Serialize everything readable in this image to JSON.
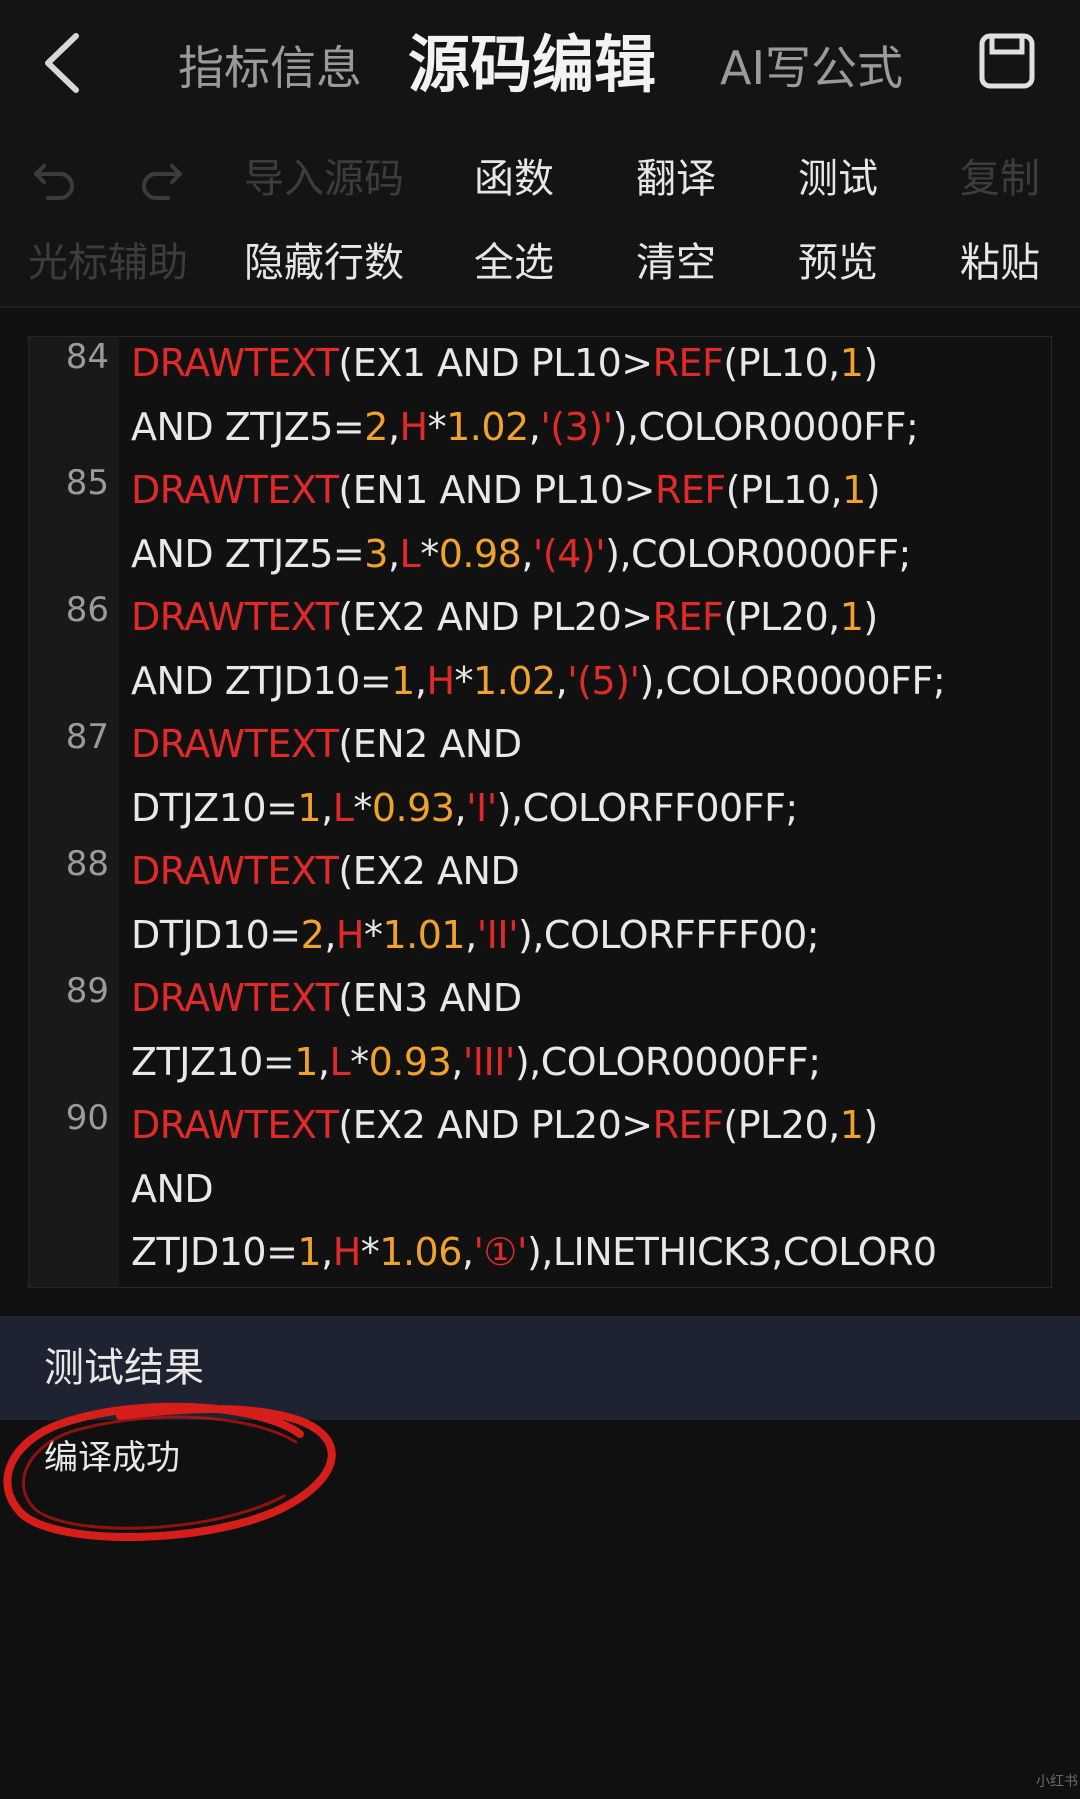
{
  "header": {
    "tabs": [
      {
        "label": "指标信息",
        "active": false
      },
      {
        "label": "源码编辑",
        "active": true
      },
      {
        "label": "AI写公式",
        "active": false
      }
    ]
  },
  "toolbar": {
    "row1": [
      "导入源码",
      "函数",
      "翻译",
      "测试",
      "复制"
    ],
    "row2": [
      "光标辅助",
      "隐藏行数",
      "全选",
      "清空",
      "预览",
      "粘贴"
    ]
  },
  "editor": {
    "line_numbers": [
      "84",
      "85",
      "86",
      "87",
      "88",
      "89",
      "90"
    ],
    "lines": [
      [
        [
          "fn",
          "DRAWTEXT"
        ],
        [
          "",
          "(EX1 AND PL10>"
        ],
        [
          "fn",
          "REF"
        ],
        [
          "",
          "(PL10,"
        ],
        [
          "num",
          "1"
        ],
        [
          "",
          ")"
        ]
      ],
      [
        [
          "",
          "AND ZTJZ5="
        ],
        [
          "num",
          "2"
        ],
        [
          "",
          ","
        ],
        [
          "fn",
          "H"
        ],
        [
          "",
          "*"
        ],
        [
          "num",
          "1.02"
        ],
        [
          "",
          ","
        ],
        [
          "str",
          "'(3)'"
        ],
        [
          "",
          "),COLOR0000FF;"
        ]
      ],
      [
        [
          "fn",
          "DRAWTEXT"
        ],
        [
          "",
          "(EN1 AND PL10>"
        ],
        [
          "fn",
          "REF"
        ],
        [
          "",
          "(PL10,"
        ],
        [
          "num",
          "1"
        ],
        [
          "",
          ")"
        ]
      ],
      [
        [
          "",
          "AND ZTJZ5="
        ],
        [
          "num",
          "3"
        ],
        [
          "",
          ","
        ],
        [
          "fn",
          "L"
        ],
        [
          "",
          "*"
        ],
        [
          "num",
          "0.98"
        ],
        [
          "",
          ","
        ],
        [
          "str",
          "'(4)'"
        ],
        [
          "",
          "),COLOR0000FF;"
        ]
      ],
      [
        [
          "fn",
          "DRAWTEXT"
        ],
        [
          "",
          "(EX2 AND PL20>"
        ],
        [
          "fn",
          "REF"
        ],
        [
          "",
          "(PL20,"
        ],
        [
          "num",
          "1"
        ],
        [
          "",
          ")"
        ]
      ],
      [
        [
          "",
          "AND ZTJD10="
        ],
        [
          "num",
          "1"
        ],
        [
          "",
          ","
        ],
        [
          "fn",
          "H"
        ],
        [
          "",
          "*"
        ],
        [
          "num",
          "1.02"
        ],
        [
          "",
          ","
        ],
        [
          "str",
          "'(5)'"
        ],
        [
          "",
          "),COLOR0000FF;"
        ]
      ],
      [
        [
          "fn",
          "DRAWTEXT"
        ],
        [
          "",
          "(EN2 AND"
        ]
      ],
      [
        [
          "",
          "DTJZ10="
        ],
        [
          "num",
          "1"
        ],
        [
          "",
          ","
        ],
        [
          "fn",
          "L"
        ],
        [
          "",
          "*"
        ],
        [
          "num",
          "0.93"
        ],
        [
          "",
          ","
        ],
        [
          "str",
          "'I'"
        ],
        [
          "",
          "),COLORFF00FF;"
        ]
      ],
      [
        [
          "fn",
          "DRAWTEXT"
        ],
        [
          "",
          "(EX2 AND"
        ]
      ],
      [
        [
          "",
          "DTJD10="
        ],
        [
          "num",
          "2"
        ],
        [
          "",
          ","
        ],
        [
          "fn",
          "H"
        ],
        [
          "",
          "*"
        ],
        [
          "num",
          "1.01"
        ],
        [
          "",
          ","
        ],
        [
          "str",
          "'II'"
        ],
        [
          "",
          "),COLORFFFF00;"
        ]
      ],
      [
        [
          "fn",
          "DRAWTEXT"
        ],
        [
          "",
          "(EN3 AND"
        ]
      ],
      [
        [
          "",
          "ZTJZ10="
        ],
        [
          "num",
          "1"
        ],
        [
          "",
          ","
        ],
        [
          "fn",
          "L"
        ],
        [
          "",
          "*"
        ],
        [
          "num",
          "0.93"
        ],
        [
          "",
          ","
        ],
        [
          "str",
          "'III'"
        ],
        [
          "",
          "),COLOR0000FF;"
        ]
      ],
      [
        [
          "fn",
          "DRAWTEXT"
        ],
        [
          "",
          "(EX2 AND PL20>"
        ],
        [
          "fn",
          "REF"
        ],
        [
          "",
          "(PL20,"
        ],
        [
          "num",
          "1"
        ],
        [
          "",
          ")"
        ]
      ],
      [
        [
          "",
          "AND"
        ]
      ],
      [
        [
          "",
          "ZTJD10="
        ],
        [
          "num",
          "1"
        ],
        [
          "",
          ","
        ],
        [
          "fn",
          "H"
        ],
        [
          "",
          "*"
        ],
        [
          "num",
          "1.06"
        ],
        [
          "",
          ","
        ],
        [
          "str",
          "'①'"
        ],
        [
          "",
          "),LINETHICK3,COLOR0"
        ]
      ]
    ]
  },
  "results": {
    "title": "测试结果",
    "message": "编译成功"
  },
  "watermark": "小红书",
  "colors": {
    "background": "#101010",
    "keyword": "#e02a2a",
    "number": "#f0a22a",
    "results_bar": "#1d2330",
    "annotation": "#e0201a"
  }
}
